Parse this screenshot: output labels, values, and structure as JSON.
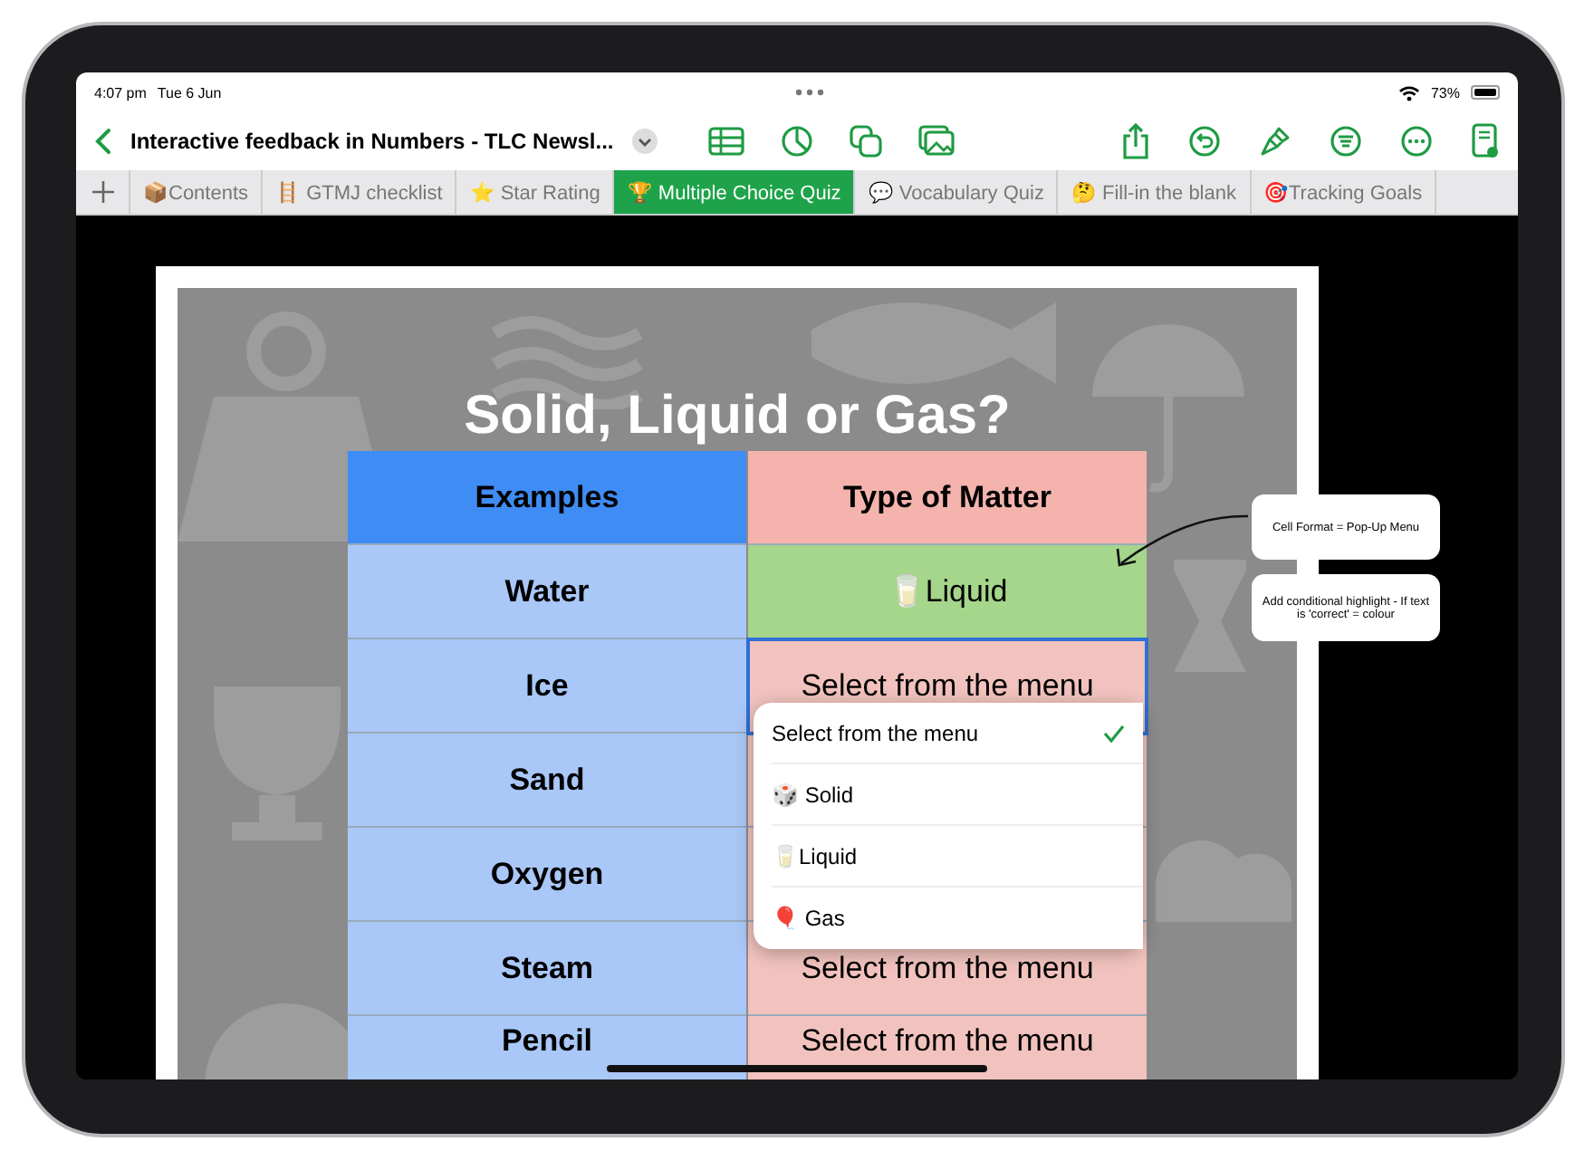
{
  "status_bar": {
    "time": "4:07 pm",
    "date": "Tue 6 Jun",
    "battery": "73%"
  },
  "toolbar": {
    "title": "Interactive feedback in Numbers - TLC Newsl..."
  },
  "tabs": [
    {
      "label": "📦Contents",
      "selected": false
    },
    {
      "label": "🪜 GTMJ checklist",
      "selected": false
    },
    {
      "label": "⭐ Star Rating",
      "selected": false
    },
    {
      "label": "🏆 Multiple Choice Quiz",
      "selected": true
    },
    {
      "label": "💬 Vocabulary Quiz",
      "selected": false
    },
    {
      "label": "🤔 Fill-in the blank",
      "selected": false
    },
    {
      "label": "🎯Tracking Goals",
      "selected": false
    }
  ],
  "sheet": {
    "title": "Solid, Liquid or Gas?",
    "columns": [
      "Examples",
      "Type of Matter"
    ],
    "rows": [
      {
        "example": "Water",
        "answer": "🥛Liquid",
        "correct": true,
        "selected": false
      },
      {
        "example": "Ice",
        "answer": "Select from the menu",
        "correct": false,
        "selected": true
      },
      {
        "example": "Sand",
        "correct": false,
        "selected": false
      },
      {
        "example": "Oxygen",
        "correct": false,
        "selected": false
      },
      {
        "example": "Steam",
        "answer": "Select from the menu",
        "correct": false,
        "selected": false
      },
      {
        "example": "Pencil",
        "answer": "Select from the menu",
        "correct": false,
        "selected": false
      }
    ]
  },
  "popup_menu": [
    {
      "label": "Select from the menu",
      "checked": true
    },
    {
      "label": "🎲 Solid",
      "checked": false
    },
    {
      "label": "🥛Liquid",
      "checked": false
    },
    {
      "label": "🎈 Gas",
      "checked": false
    }
  ],
  "callouts": [
    "Cell Format = Pop-Up Menu",
    "Add conditional highlight - If text is 'correct' = colour"
  ]
}
